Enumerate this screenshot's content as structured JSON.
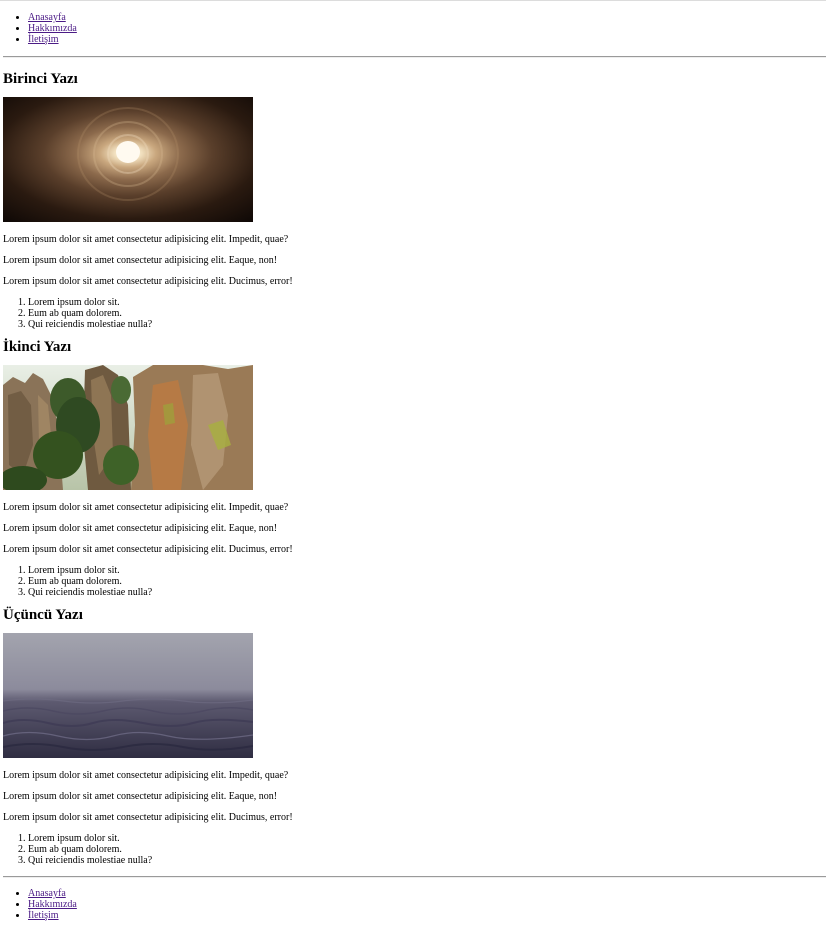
{
  "nav_top": {
    "items": [
      {
        "label": "Anasayfa"
      },
      {
        "label": "Hakkımızda"
      },
      {
        "label": "İletişim"
      }
    ]
  },
  "posts": [
    {
      "title": "Birinci Yazı",
      "image": "tunnel-photo",
      "paragraphs": [
        "Lorem ipsum dolor sit amet consectetur adipisicing elit. Impedit, quae?",
        "Lorem ipsum dolor sit amet consectetur adipisicing elit. Eaque, non!",
        "Lorem ipsum dolor sit amet consectetur adipisicing elit. Ducimus, error!"
      ],
      "list": [
        "Lorem ipsum dolor sit.",
        "Eum ab quam dolorem.",
        "Qui reiciendis molestiae nulla?"
      ]
    },
    {
      "title": "İkinci Yazı",
      "image": "rock-cliffs-photo",
      "paragraphs": [
        "Lorem ipsum dolor sit amet consectetur adipisicing elit. Impedit, quae?",
        "Lorem ipsum dolor sit amet consectetur adipisicing elit. Eaque, non!",
        "Lorem ipsum dolor sit amet consectetur adipisicing elit. Ducimus, error!"
      ],
      "list": [
        "Lorem ipsum dolor sit.",
        "Eum ab quam dolorem.",
        "Qui reiciendis molestiae nulla?"
      ]
    },
    {
      "title": "Üçüncü Yazı",
      "image": "foggy-sea-photo",
      "paragraphs": [
        "Lorem ipsum dolor sit amet consectetur adipisicing elit. Impedit, quae?",
        "Lorem ipsum dolor sit amet consectetur adipisicing elit. Eaque, non!",
        "Lorem ipsum dolor sit amet consectetur adipisicing elit. Ducimus, error!"
      ],
      "list": [
        "Lorem ipsum dolor sit.",
        "Eum ab quam dolorem.",
        "Qui reiciendis molestiae nulla?"
      ]
    }
  ],
  "nav_bottom": {
    "items": [
      {
        "label": "Anasayfa"
      },
      {
        "label": "Hakkımızda"
      },
      {
        "label": "İletişim"
      }
    ]
  },
  "colors": {
    "link": "#4b1b86",
    "text": "#000000",
    "rule": "#9a9a9a"
  }
}
